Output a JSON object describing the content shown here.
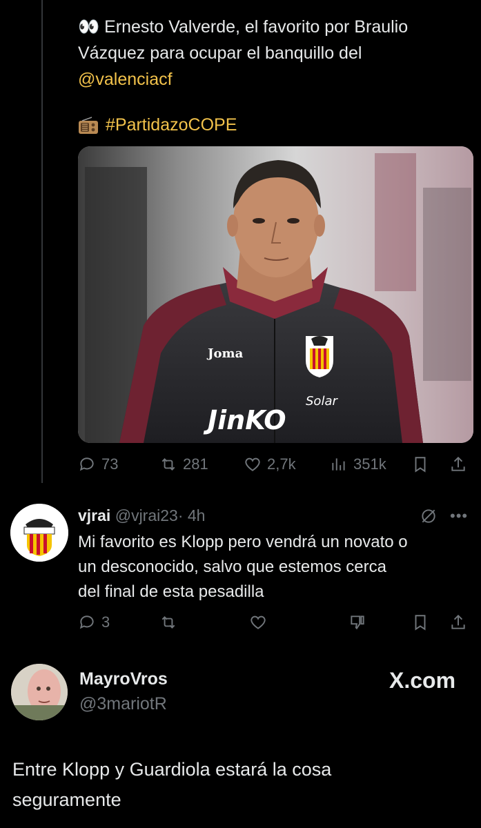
{
  "tweet": {
    "line1_emoji": "👀",
    "line1_text": "Ernesto Valverde, el favorito por Braulio",
    "line2_text": "Vázquez para ocupar el banquillo del",
    "mention": "@valenciacf",
    "hashtag": "#PartidazoCOPE",
    "photo": {
      "jacket_brand": "Joma",
      "sponsor_top": "Solar",
      "sponsor_bottom": "JinKO"
    },
    "stats": {
      "replies": "73",
      "retweets": "281",
      "likes": "2,7k",
      "views": "351k"
    }
  },
  "reply": {
    "name": "vjrai",
    "handle": "@vjrai23",
    "time": "· 4h",
    "text_line1": "Mi favorito es Klopp pero vendrá un novato o",
    "text_line2": "un desconocido, salvo que estemos cerca",
    "text_line3": "del final de esta pesadilla",
    "replies": "3"
  },
  "comment": {
    "name": "MayroVros",
    "handle": "@3mariotR",
    "brand": "X.com",
    "text_line1": "Entre Klopp y Guardiola estará la cosa",
    "text_line2": "seguramente"
  },
  "colors": {
    "background": "#000000",
    "text": "#e7e9ea",
    "muted": "#71767b",
    "link": "#f2c24b"
  }
}
